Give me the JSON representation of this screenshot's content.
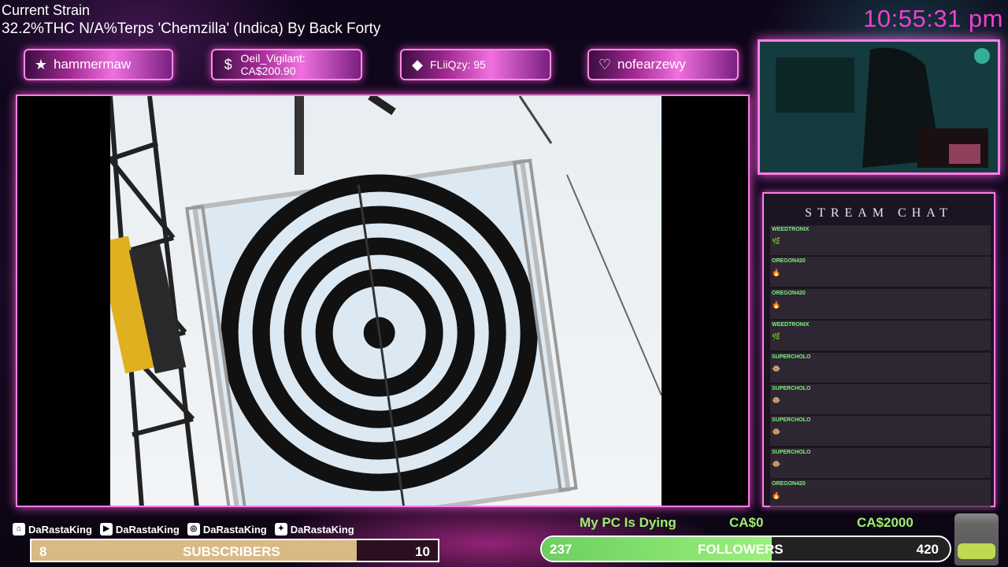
{
  "header": {
    "title": "Current Strain",
    "strain": "32.2%THC N/A%Terps 'Chemzilla' (Indica) By Back Forty",
    "clock": "10:55:31 pm"
  },
  "alerts": [
    {
      "icon": "★",
      "icon_name": "star-icon",
      "text": "hammermaw"
    },
    {
      "icon": "$",
      "icon_name": "dollar-icon",
      "text": "Oeil_Vigilant: CA$200.90"
    },
    {
      "icon": "◆",
      "icon_name": "diamond-icon",
      "text": "FLiiQzy: 95"
    },
    {
      "icon": "♡",
      "icon_name": "heart-icon",
      "text": "nofearzewy"
    }
  ],
  "chat": {
    "title": "STREAM CHAT",
    "messages": [
      {
        "user": "WEEDTRONIX",
        "emote": "🌿"
      },
      {
        "user": "OREGON420",
        "emote": "🔥"
      },
      {
        "user": "OREGON420",
        "emote": "🔥"
      },
      {
        "user": "WEEDTRONIX",
        "emote": "🌿"
      },
      {
        "user": "SUPERCHOLO",
        "emote": "🐵"
      },
      {
        "user": "SUPERCHOLO",
        "emote": "🐵"
      },
      {
        "user": "SUPERCHOLO",
        "emote": "🐵"
      },
      {
        "user": "SUPERCHOLO",
        "emote": "🐵"
      },
      {
        "user": "OREGON420",
        "emote": "🔥"
      }
    ]
  },
  "social": [
    {
      "icon": "twitch-icon",
      "glyph": "⌂",
      "label": "DaRastaKing"
    },
    {
      "icon": "youtube-icon",
      "glyph": "▶",
      "label": "DaRastaKing"
    },
    {
      "icon": "instagram-icon",
      "glyph": "◎",
      "label": "DaRastaKing"
    },
    {
      "icon": "twitter-icon",
      "glyph": "✦",
      "label": "DaRastaKing"
    }
  ],
  "subscribers": {
    "current": "8",
    "label": "SUBSCRIBERS",
    "goal": "10",
    "progress": 0.8
  },
  "donation": {
    "title": "My PC Is Dying",
    "current": "CA$0",
    "goal": "CA$2000"
  },
  "followers": {
    "current": "237",
    "label": "FOLLOWERS",
    "goal": "420",
    "progress": 0.564
  },
  "colors": {
    "accent": "#ff7ee6",
    "clock": "#f040d0",
    "chat_user": "#7cf07c",
    "sub_fill": "#d9b985",
    "follow_fill": "#7ee06a"
  }
}
